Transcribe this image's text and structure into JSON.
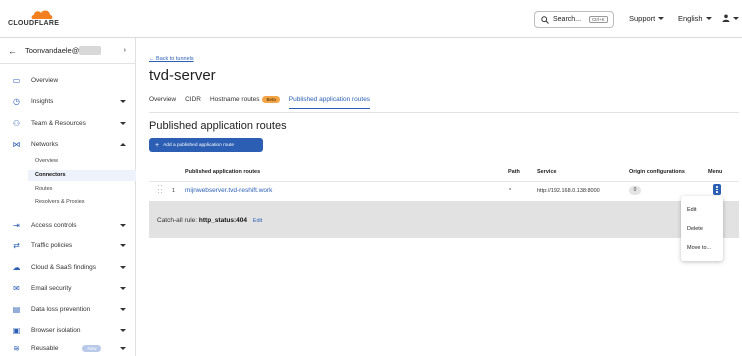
{
  "topbar": {
    "logo_text": "CLOUDFLARE",
    "search_label": "Search...",
    "search_shortcut": "Ctrl+K",
    "support_label": "Support",
    "language_label": "English",
    "accent": "#f38020"
  },
  "sidebar": {
    "account_name": "Toonvandaele@",
    "items": [
      {
        "label": "Overview",
        "icon": "page-icon"
      },
      {
        "label": "Insights",
        "icon": "clock-icon"
      },
      {
        "label": "Team & Resources",
        "icon": "people-icon"
      },
      {
        "label": "Networks",
        "icon": "network-icon"
      },
      {
        "label": "Access controls",
        "icon": "arrow-in-icon"
      },
      {
        "label": "Traffic policies",
        "icon": "arrow-split-icon"
      },
      {
        "label": "Cloud & SaaS findings",
        "icon": "cloud-icon"
      },
      {
        "label": "Email security",
        "icon": "email-icon"
      },
      {
        "label": "Data loss prevention",
        "icon": "document-icon"
      },
      {
        "label": "Browser isolation",
        "icon": "browser-icon"
      },
      {
        "label": "Reusable",
        "icon": "stack-icon"
      }
    ],
    "networks_sub": [
      "Overview",
      "Connectors",
      "Routes",
      "Resolvers & Proxies"
    ],
    "badge": "New"
  },
  "main": {
    "back_link": "← Back to tunnels",
    "title": "tvd-server",
    "tabs": [
      {
        "label": "Overview"
      },
      {
        "label": "CIDR"
      },
      {
        "label": "Hostname routes",
        "badge": "Beta"
      },
      {
        "label": "Published application routes"
      }
    ],
    "section_title": "Published application routes",
    "add_button": "Add a published application route",
    "columns": {
      "route": "Published application routes",
      "path": "Path",
      "service": "Service",
      "origin": "Origin configurations",
      "menu": "Menu"
    },
    "rows": [
      {
        "index": "1",
        "route": "mijnwebserver.tvd-reshift.work",
        "path": "*",
        "service": "http://192.168.0.138:8000",
        "origin": "0"
      }
    ],
    "catchall_label": "Catch-all rule:",
    "catchall_value": "http_status:404",
    "catchall_edit": "Edit",
    "menu_items": [
      "Edit",
      "Delete",
      "Move to..."
    ]
  }
}
